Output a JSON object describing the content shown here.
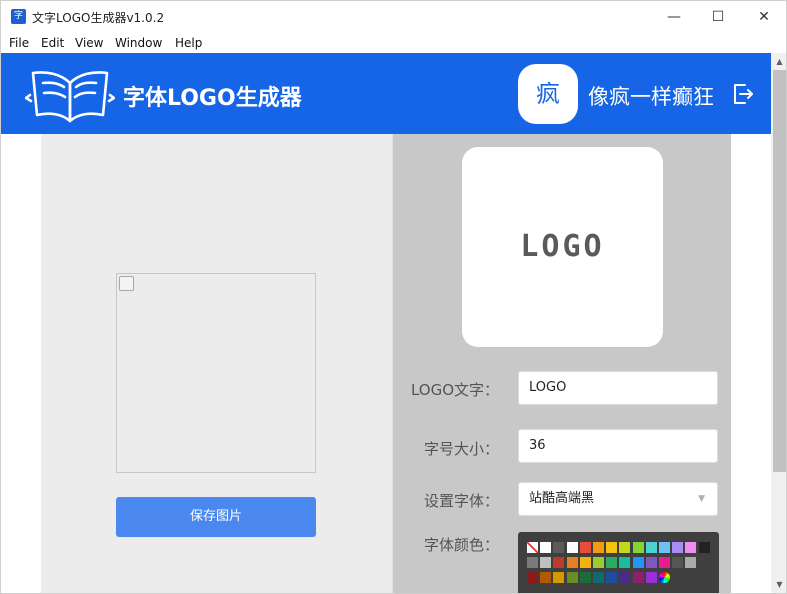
{
  "window": {
    "title": "文字LOGO生成器v1.0.2",
    "app_icon_char": "字",
    "minimize_glyph": "—",
    "maximize_glyph": "☐",
    "close_glyph": "✕"
  },
  "menu": {
    "items": [
      "File",
      "Edit",
      "View",
      "Window",
      "Help"
    ]
  },
  "header": {
    "app_name": "字体LOGO生成器",
    "avatar_char": "疯",
    "user_name": "像疯一样癫狂",
    "logo_icon": "open-book-icon",
    "logout_icon": "logout-icon",
    "brand_color": "#1565e6"
  },
  "left": {
    "save_button": "保存图片",
    "save_button_color": "#4a88ef"
  },
  "right": {
    "preview_text": "LOGO",
    "logo_text_label": "LOGO文字：",
    "logo_text_value": "LOGO",
    "font_size_label": "字号大小：",
    "font_size_value": "36",
    "font_family_label": "设置字体：",
    "font_family_value": "站酷高端黑",
    "font_color_label": "字体颜色："
  },
  "palette": {
    "rows": [
      [
        "none",
        "#ffffff",
        "#5a5a5a",
        "#ffffff",
        "#e74c3c",
        "#f39c12",
        "#f1c40f",
        "#c2d81f",
        "#86d434",
        "#4cd2d2",
        "#6ec1f5",
        "#a88cf2",
        "#f08cf2",
        "#222222"
      ],
      [
        "#7a7a7a",
        "#c0c0c0",
        "#c0392b",
        "#e67e22",
        "#f1b40f",
        "#9acd32",
        "#27ae60",
        "#1abc9c",
        "#2196f3",
        "#7e57c2",
        "#e91e8c",
        "#555555",
        "#aaaaaa"
      ],
      [
        "#8b1a1a",
        "#b35900",
        "#d49b00",
        "#6b8e23",
        "#1e6b3a",
        "#0e6b6b",
        "#1b4f9c",
        "#4b2a8a",
        "#8e1f6b",
        "#9b2fd6",
        "picker"
      ]
    ]
  },
  "scrollbar": {
    "up_glyph": "▲",
    "down_glyph": "▼"
  }
}
